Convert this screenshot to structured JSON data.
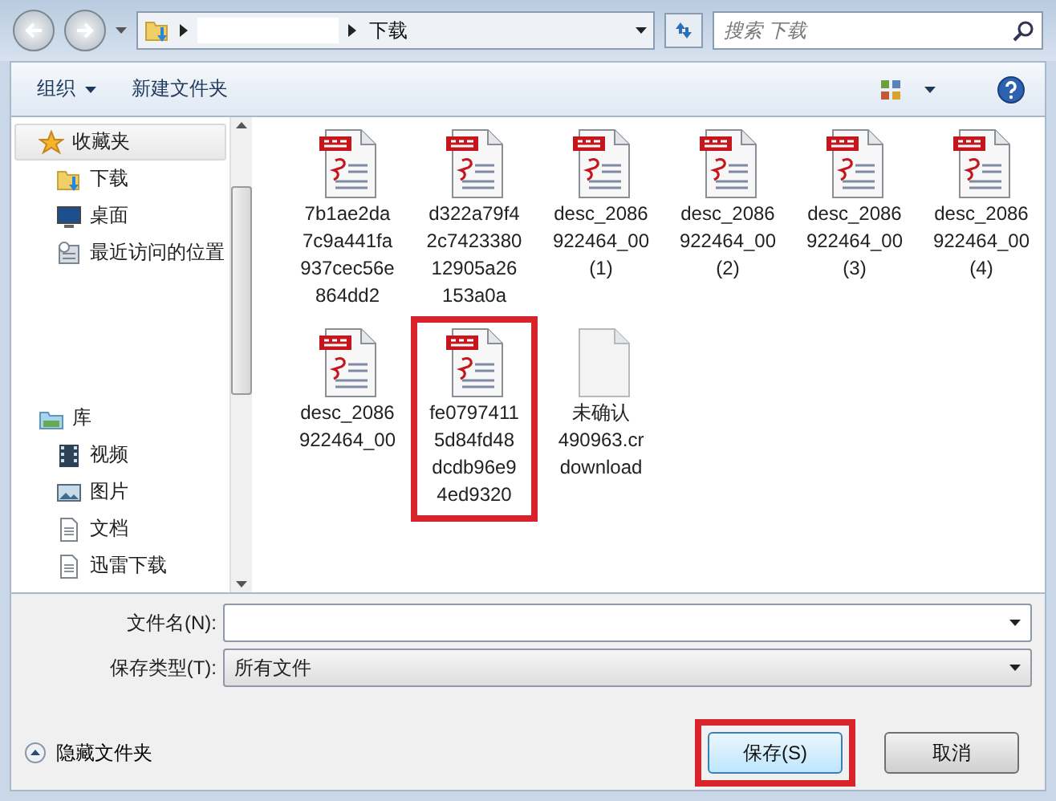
{
  "nav": {
    "breadcrumb": [
      {
        "label": "下载"
      }
    ],
    "search": {
      "placeholder": "搜索 下载"
    }
  },
  "toolbar": {
    "buttons": [
      {
        "label": "组织",
        "kind": "menu"
      },
      {
        "label": "新建文件夹",
        "kind": "plain"
      }
    ]
  },
  "sidebar": {
    "groups": [
      {
        "label": "收藏夹",
        "kind": "favorites",
        "selected": true,
        "children": [
          {
            "label": "下载",
            "kind": "download"
          },
          {
            "label": "桌面",
            "kind": "desktop"
          },
          {
            "label": "最近访问的位置",
            "kind": "recent"
          }
        ]
      },
      {
        "label": "库",
        "kind": "library",
        "selected": false,
        "children": [
          {
            "label": "视频",
            "kind": "video"
          },
          {
            "label": "图片",
            "kind": "picture"
          },
          {
            "label": "文档",
            "kind": "document"
          },
          {
            "label": "迅雷下载",
            "kind": "document"
          }
        ]
      }
    ]
  },
  "files": [
    {
      "name_lines": [
        "7b1ae2da",
        "7c9a441fa",
        "937cec56e",
        "864dd2"
      ],
      "kind": "pdf",
      "highlighted": false
    },
    {
      "name_lines": [
        "d322a79f4",
        "2c7423380",
        "12905a26",
        "153a0a"
      ],
      "kind": "pdf",
      "highlighted": false
    },
    {
      "name_lines": [
        "desc_2086",
        "922464_00",
        "(1)"
      ],
      "kind": "pdf",
      "highlighted": false
    },
    {
      "name_lines": [
        "desc_2086",
        "922464_00",
        "(2)"
      ],
      "kind": "pdf",
      "highlighted": false
    },
    {
      "name_lines": [
        "desc_2086",
        "922464_00",
        "(3)"
      ],
      "kind": "pdf",
      "highlighted": false
    },
    {
      "name_lines": [
        "desc_2086",
        "922464_00",
        "(4)"
      ],
      "kind": "pdf",
      "highlighted": false
    },
    {
      "name_lines": [
        "desc_2086",
        "922464_00"
      ],
      "kind": "pdf",
      "highlighted": false
    },
    {
      "name_lines": [
        "fe0797411",
        "5d84fd48",
        "dcdb96e9",
        "4ed9320"
      ],
      "kind": "pdf",
      "highlighted": true
    },
    {
      "name_lines": [
        "未确认",
        "490963.cr",
        "download"
      ],
      "kind": "blank",
      "highlighted": false
    }
  ],
  "form": {
    "fields": [
      {
        "label": "文件名(N):",
        "kind": "combo"
      },
      {
        "label": "保存类型(T):",
        "value": "所有文件",
        "kind": "select"
      }
    ],
    "hide_folders": "隐藏文件夹",
    "buttons": [
      {
        "label": "保存(S)",
        "kind": "primary",
        "highlighted": true
      },
      {
        "label": "取消",
        "kind": "plain",
        "highlighted": false
      }
    ]
  }
}
